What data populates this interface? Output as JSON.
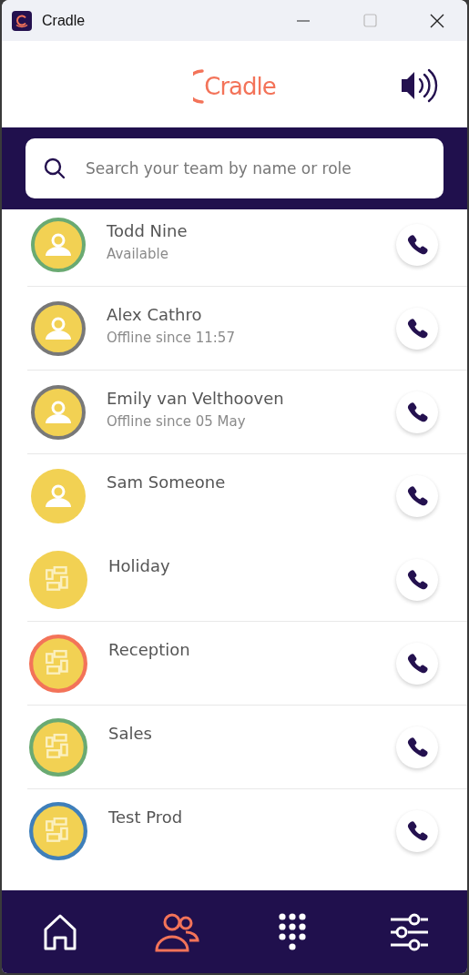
{
  "window": {
    "title": "Cradle"
  },
  "header": {
    "logo_text": "Cradle",
    "sound_on": true
  },
  "search": {
    "placeholder": "Search your team by name or role"
  },
  "people": [
    {
      "name": "Todd Nine",
      "status": "Available",
      "color": "#6aaa72"
    },
    {
      "name": "Alex Cathro",
      "status": "Offline since 11:57",
      "color": "#787878"
    },
    {
      "name": "Emily van Velthooven",
      "status": "Offline since 05 May",
      "color": "#787878"
    },
    {
      "name": "Sam Someone"
    }
  ],
  "groups": [
    {
      "name": "Holiday"
    },
    {
      "name": "Reception",
      "color": "#f37359"
    },
    {
      "name": "Sales",
      "color": "#6aaa72"
    },
    {
      "name": "Test Prod",
      "color": "#3f7fba"
    }
  ],
  "nav": [
    {
      "kind": "home",
      "selected": false
    },
    {
      "kind": "team",
      "selected": true
    },
    {
      "kind": "keypad",
      "selected": false
    },
    {
      "kind": "settings",
      "selected": false
    }
  ]
}
